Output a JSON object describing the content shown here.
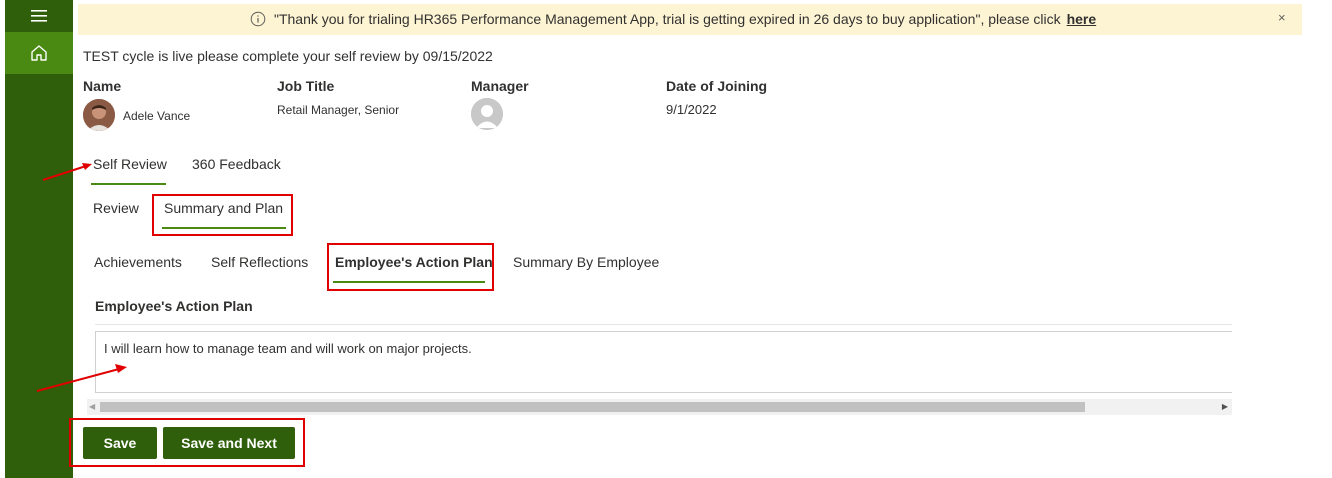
{
  "sidebar": {
    "menu_icon": "hamburger-icon",
    "home_icon": "home-icon"
  },
  "banner": {
    "icon": "info-icon",
    "text": "\"Thank you for trialing HR365 Performance Management App, trial is getting expired in 26 days to buy application\", please click",
    "link": "here",
    "close": "×"
  },
  "notice": "TEST cycle is live please complete your self review by 09/15/2022",
  "employee": {
    "name_label": "Name",
    "name": "Adele Vance",
    "job_title_label": "Job Title",
    "job_title": "Retail Manager, Senior",
    "manager_label": "Manager",
    "doj_label": "Date of Joining",
    "doj": "9/1/2022"
  },
  "main_tabs": [
    {
      "label": "Self Review",
      "selected": true
    },
    {
      "label": "360 Feedback",
      "selected": false
    }
  ],
  "sub_tabs": [
    {
      "label": "Review",
      "selected": false
    },
    {
      "label": "Summary and Plan",
      "selected": true
    }
  ],
  "section_tabs": [
    {
      "label": "Achievements",
      "selected": false
    },
    {
      "label": "Self Reflections",
      "selected": false
    },
    {
      "label": "Employee's Action Plan",
      "selected": true
    },
    {
      "label": "Summary By Employee",
      "selected": false
    }
  ],
  "section_title": "Employee's Action Plan",
  "action_plan_text": "I will learn how to manage team and  will work on major projects.",
  "buttons": {
    "save": "Save",
    "save_next": "Save and Next"
  },
  "colors": {
    "sidebar": "#2f5f0a",
    "accent": "#4a8a12",
    "banner_bg": "#fdf4d4",
    "highlight": "#e00000"
  }
}
